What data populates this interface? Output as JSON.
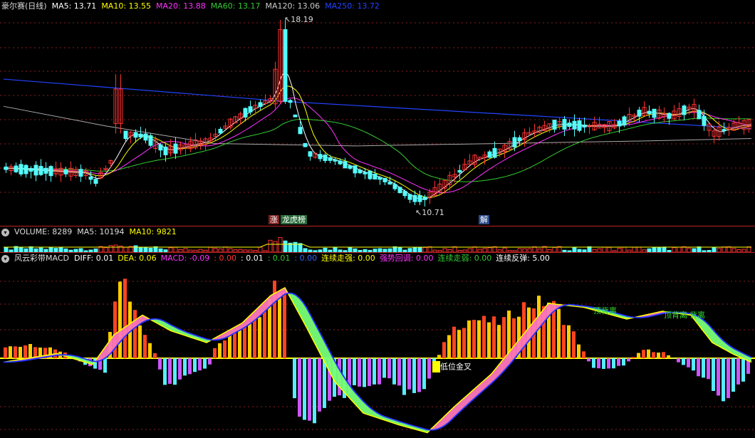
{
  "main": {
    "title": "豪尔赛(日线)",
    "ma": [
      {
        "label": "MA5: 13.71",
        "color": "#ffffff"
      },
      {
        "label": "MA10: 13.55",
        "color": "#ffff00"
      },
      {
        "label": "MA20: 13.88",
        "color": "#ff33ff"
      },
      {
        "label": "MA60: 13.17",
        "color": "#33cc33"
      },
      {
        "label": "MA120: 13.06",
        "color": "#cccccc"
      },
      {
        "label": "MA250: 13.72",
        "color": "#2244ff"
      }
    ],
    "high_label": "18.19",
    "low_label": "10.71",
    "tag1": "涨",
    "tag2": "龙虎榜",
    "tag3": "解",
    "high_value": 18.19,
    "low_value": 10.71
  },
  "volume": {
    "title": "VOLUME: 8289",
    "ma5": "MA5: 10194",
    "ma10": "MA10: 9821"
  },
  "macd": {
    "title": "风云彩带MACD",
    "items": [
      {
        "label": "DIFF: 0.01",
        "color": "#ffffff"
      },
      {
        "label": "DEA: 0.06",
        "color": "#ffff00"
      },
      {
        "label": "MACD: -0.09",
        "color": "#ff33ff"
      },
      {
        "label": ": 0.00",
        "color": "#ff3333"
      },
      {
        "label": ": 0.01",
        "color": "#ffffff"
      },
      {
        "label": ": 0.01",
        "color": "#33cc33"
      },
      {
        "label": ": 0.00",
        "color": "#3366ff"
      },
      {
        "label": "连续走强: 0.00",
        "color": "#ffff00"
      },
      {
        "label": "强势回调: 0.00",
        "color": "#ff33ff"
      },
      {
        "label": "连续走弱: 0.00",
        "color": "#33cc33"
      },
      {
        "label": "连续反弹: 5.00",
        "color": "#ffffff"
      }
    ],
    "annotations": {
      "golden_cross": "低位金叉",
      "top_div1": "顶背离",
      "top_div2": "顶背离",
      "top_div3": "背离"
    }
  },
  "colors": {
    "up": "#ff3232",
    "down": "#54fcfc",
    "separator": "#b22222",
    "grid": "#8a1f1f"
  }
}
